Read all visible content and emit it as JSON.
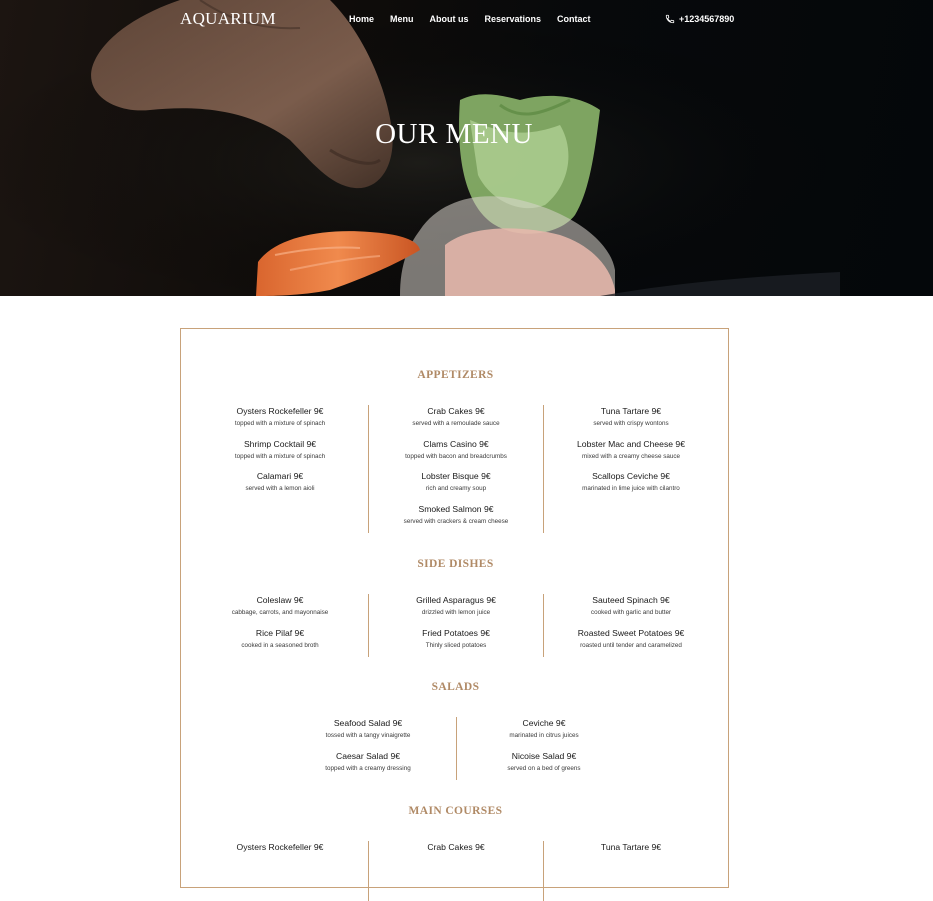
{
  "brand": {
    "logo": "AQUARIUM"
  },
  "nav": {
    "links": [
      "Home",
      "Menu",
      "About us",
      "Reservations",
      "Contact"
    ],
    "phone": "+1234567890",
    "phone_icon": "phone-icon"
  },
  "hero": {
    "title": "OUR MENU"
  },
  "colors": {
    "accent": "#c8a27a",
    "section_title": "#b08a66",
    "hero_bg": "#07090b"
  },
  "menu": {
    "appetizers": {
      "title": "APPETIZERS",
      "col1": [
        {
          "name": "Oysters Rockefeller 9€",
          "desc": "topped with a mixture of spinach"
        },
        {
          "name": "Shrimp Cocktail 9€",
          "desc": "topped with a mixture of spinach"
        },
        {
          "name": "Calamari 9€",
          "desc": "served with a lemon aioli"
        }
      ],
      "col2": [
        {
          "name": "Crab Cakes 9€",
          "desc": "served with a remoulade sauce"
        },
        {
          "name": "Clams Casino 9€",
          "desc": "topped with bacon and breadcrumbs"
        },
        {
          "name": "Lobster Bisque 9€",
          "desc": "rich and creamy soup"
        },
        {
          "name": "Smoked Salmon 9€",
          "desc": "served with crackers & cream cheese"
        }
      ],
      "col3": [
        {
          "name": "Tuna Tartare 9€",
          "desc": "served with crispy wontons"
        },
        {
          "name": "Lobster Mac and Cheese 9€",
          "desc": "mixed with a creamy cheese sauce"
        },
        {
          "name": "Scallops Ceviche 9€",
          "desc": "marinated in lime juice with cilantro"
        }
      ]
    },
    "side_dishes": {
      "title": "SIDE DISHES",
      "col1": [
        {
          "name": "Coleslaw 9€",
          "desc": "cabbage, carrots, and mayonnaise"
        },
        {
          "name": "Rice Pilaf 9€",
          "desc": "cooked in a seasoned broth"
        }
      ],
      "col2": [
        {
          "name": "Grilled Asparagus 9€",
          "desc": "drizzled with lemon juice"
        },
        {
          "name": "Fried Potatoes 9€",
          "desc": "Thinly sliced potatoes"
        }
      ],
      "col3": [
        {
          "name": "Sauteed Spinach 9€",
          "desc": "cooked with garlic and butter"
        },
        {
          "name": "Roasted Sweet Potatoes 9€",
          "desc": "roasted until tender and caramelized"
        }
      ]
    },
    "salads": {
      "title": "SALADS",
      "col1": [
        {
          "name": "Seafood Salad 9€",
          "desc": "tossed with a tangy vinaigrette"
        },
        {
          "name": "Caesar Salad 9€",
          "desc": "topped with a creamy dressing"
        }
      ],
      "col2": [
        {
          "name": "Ceviche 9€",
          "desc": "marinated in citrus juices"
        },
        {
          "name": "Nicoise Salad 9€",
          "desc": "served on a bed of greens"
        }
      ]
    },
    "main_courses": {
      "title": "MAIN COURSES",
      "col1": [
        {
          "name": "Oysters Rockefeller 9€"
        }
      ],
      "col2": [
        {
          "name": "Crab Cakes 9€"
        }
      ],
      "col3": [
        {
          "name": "Tuna Tartare 9€"
        }
      ]
    }
  }
}
